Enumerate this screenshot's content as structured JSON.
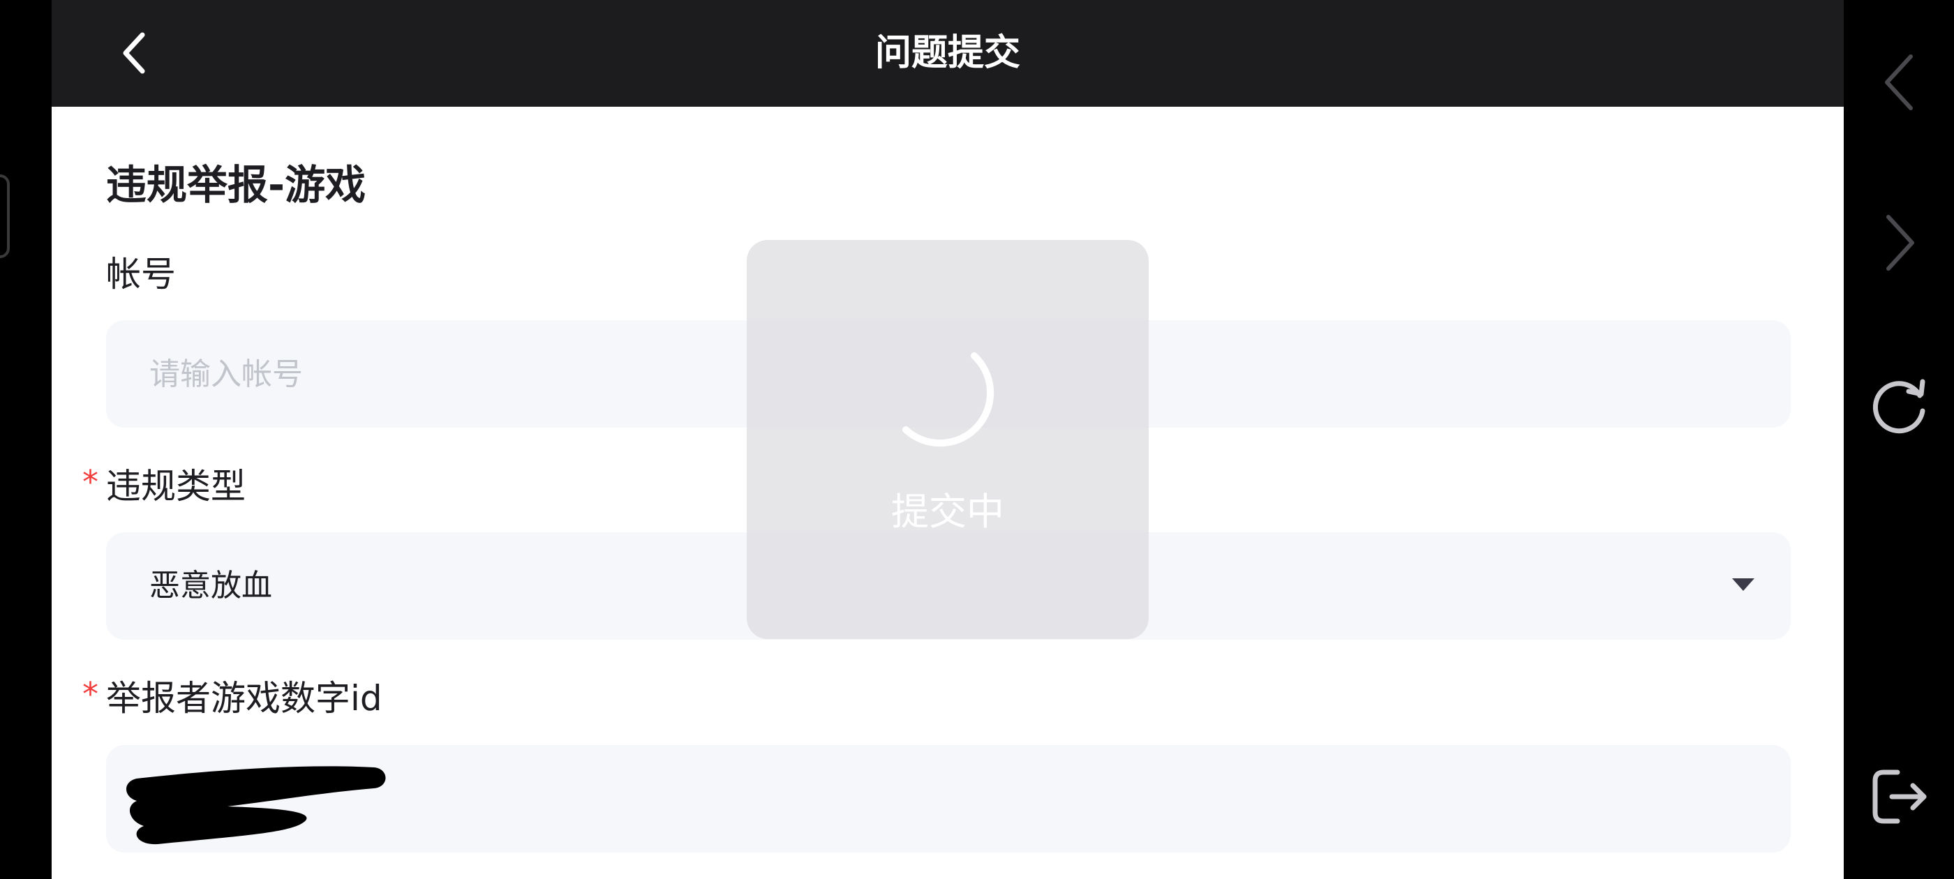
{
  "header": {
    "title": "问题提交",
    "back_icon": "chevron-left-icon"
  },
  "form": {
    "section_title": "违规举报-游戏",
    "account": {
      "label": "帐号",
      "placeholder": "请输入帐号",
      "value": ""
    },
    "violation_type": {
      "label": "违规类型",
      "required_mark": "*",
      "selected": "恶意放血",
      "icon": "caret-down-icon"
    },
    "reporter_id": {
      "label": "举报者游戏数字id",
      "required_mark": "*",
      "value_redacted": true
    }
  },
  "toast": {
    "text": "提交中",
    "icon": "loading-spinner-icon"
  },
  "side_controls": {
    "items": [
      {
        "name": "back",
        "icon": "chevron-left-icon"
      },
      {
        "name": "forward",
        "icon": "chevron-right-icon"
      },
      {
        "name": "refresh",
        "icon": "refresh-icon"
      },
      {
        "name": "exit",
        "icon": "exit-icon"
      }
    ]
  },
  "colors": {
    "header_bg": "#1c1c1e",
    "field_bg": "#f6f7fa",
    "required": "#f23b3b",
    "toast_bg": "#dcdde0"
  }
}
